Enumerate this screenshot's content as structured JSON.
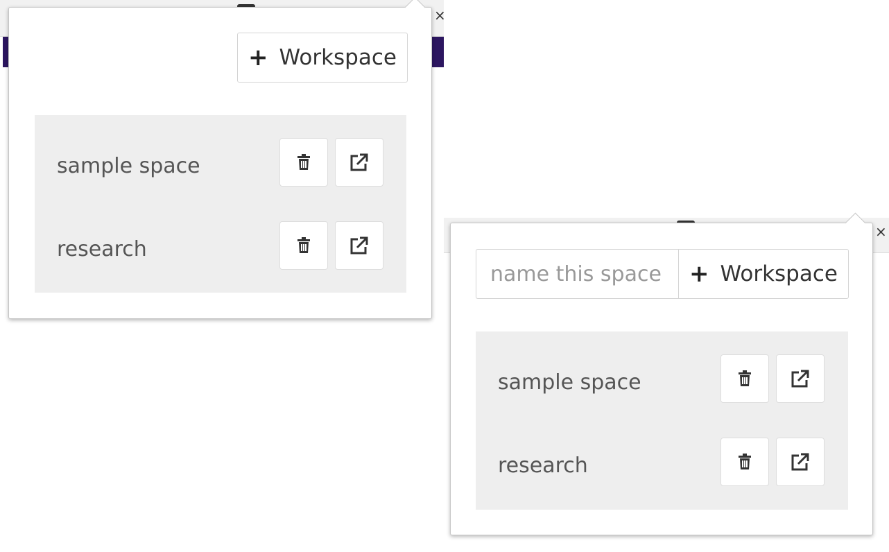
{
  "popup_collapsed": {
    "add_button": {
      "icon": "plus-icon",
      "label": "Workspace"
    },
    "workspaces": [
      {
        "name": "sample space",
        "delete_icon": "trash-icon",
        "open_icon": "external-link-icon"
      },
      {
        "name": "research",
        "delete_icon": "trash-icon",
        "open_icon": "external-link-icon"
      }
    ]
  },
  "popup_expanded": {
    "name_input": {
      "placeholder": "name this space",
      "value": ""
    },
    "add_button": {
      "icon": "plus-icon",
      "label": "Workspace"
    },
    "workspaces": [
      {
        "name": "sample space",
        "delete_icon": "trash-icon",
        "open_icon": "external-link-icon"
      },
      {
        "name": "research",
        "delete_icon": "trash-icon",
        "open_icon": "external-link-icon"
      }
    ]
  },
  "background": {
    "close_glyph": "×",
    "accent_color": "#2c1660"
  }
}
